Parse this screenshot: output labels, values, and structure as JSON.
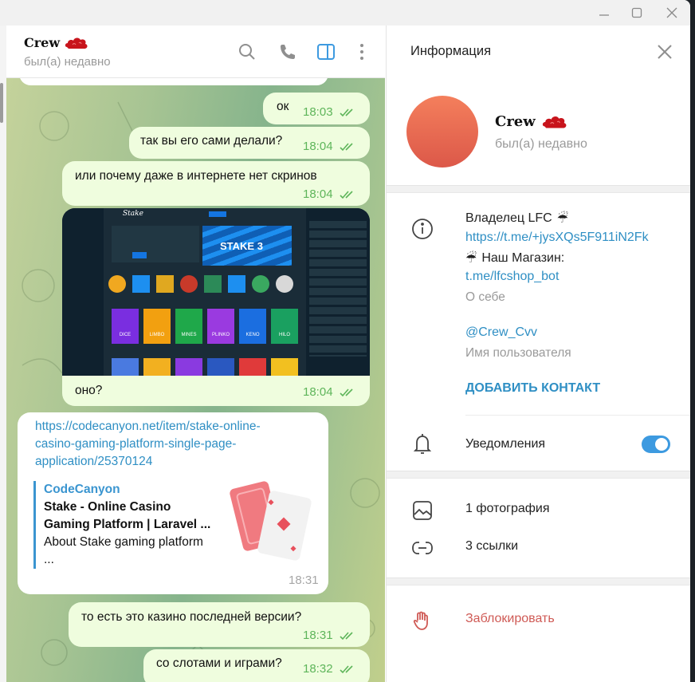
{
  "window": {
    "controls": {
      "minimize": "minimize",
      "maximize": "maximize",
      "close": "close"
    }
  },
  "chat_header": {
    "name": "Crew",
    "name_emoji": "red-cloud",
    "status": "был(а) недавно",
    "icons": [
      "search-icon",
      "phone-icon",
      "sidebar-toggle-icon",
      "more-vertical-icon"
    ],
    "accent": "#3d9ae0"
  },
  "messages": [
    {
      "direction": "out",
      "text": "ок",
      "time": "18:03",
      "read": true
    },
    {
      "direction": "out",
      "text": "так вы его сами делали?",
      "time": "18:04",
      "read": true
    },
    {
      "direction": "out",
      "text": "или почему даже в интернете нет скринов",
      "time": "18:04",
      "read": true
    },
    {
      "direction": "out",
      "type": "photo",
      "photo_desc": "Stake casino website screenshot",
      "photo_text": {
        "logo": "Stake",
        "banner": "STAKE 3",
        "tiles": [
          "DICE",
          "LIMBO",
          "MINES",
          "PLINKO",
          "KENO",
          "HILO"
        ]
      },
      "text": "оно?",
      "time": "18:04",
      "read": true
    },
    {
      "direction": "in",
      "type": "link",
      "url_lines": [
        "https://codecanyon.net/item/stake-online-",
        "casino-gaming-platform-single-page-",
        "application/25370124"
      ],
      "preview": {
        "site": "CodeCanyon",
        "title_lines": [
          "Stake - Online Casino",
          "Gaming Platform | Laravel ..."
        ],
        "desc_lines": [
          "About Stake gaming platform",
          "..."
        ]
      },
      "time": "18:31"
    },
    {
      "direction": "out",
      "text": "то есть это казино последней версии?",
      "time": "18:31",
      "read": true
    },
    {
      "direction": "out",
      "text": "со слотами и играми?",
      "time": "18:32",
      "read": true
    }
  ],
  "info_panel": {
    "title": "Информация",
    "name": "Crew",
    "status": "был(а) недавно",
    "avatar_colors": [
      "#f47f5c",
      "#dc5849"
    ],
    "bio": {
      "line1": "Владелец LFC",
      "link1": "https://t.me/+jysXQs5F911iN2Fk",
      "line3": "Наш Магазин:",
      "link2": "t.me/lfcshop_bot",
      "label": "О себе"
    },
    "username": {
      "value": "@Crew_Cvv",
      "label": "Имя пользователя"
    },
    "add_contact": "ДОБАВИТЬ КОНТАКТ",
    "notifications": {
      "label": "Уведомления",
      "enabled": true
    },
    "media": [
      {
        "icon": "photo-icon",
        "label": "1 фотография"
      },
      {
        "icon": "link-icon",
        "label": "3 ссылки"
      }
    ],
    "block": "Заблокировать",
    "block_color": "#cf5a55",
    "link_color": "#2f8fc4"
  }
}
